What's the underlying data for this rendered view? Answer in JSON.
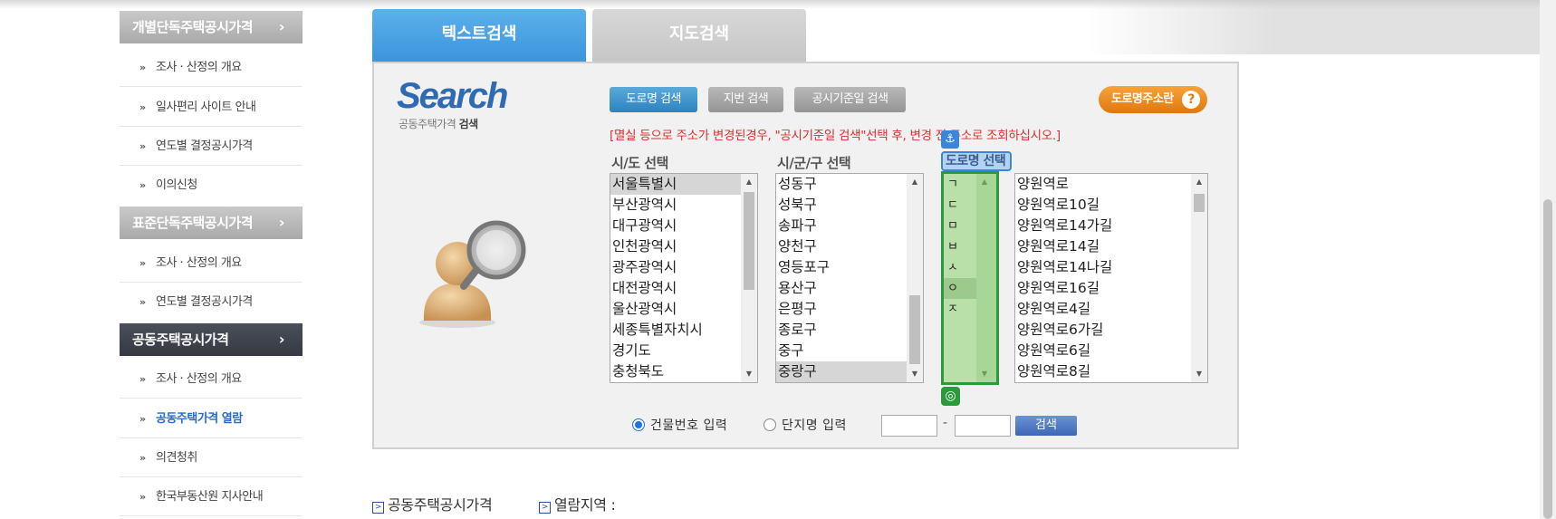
{
  "sidebar": {
    "sections": [
      {
        "title": "개별단독주택공시가격",
        "chevron": "›",
        "items": [
          "조사 · 산정의 개요",
          "일사편리 사이트 안내",
          "연도별 결정공시가격",
          "이의신청"
        ]
      },
      {
        "title": "표준단독주택공시가격",
        "chevron": "›",
        "items": [
          "조사 · 산정의 개요",
          "연도별 결정공시가격"
        ]
      },
      {
        "title": "공동주택공시가격",
        "chevron": "›",
        "items": [
          "조사 · 산정의 개요",
          "공동주택가격 열람",
          "의견청취",
          "한국부동산원 지사안내"
        ]
      }
    ],
    "bullet": "»"
  },
  "tabs": {
    "text_search": "텍스트검색",
    "map_search": "지도검색"
  },
  "search": {
    "logo": "Search",
    "logo_sub_prefix": "공동주택가격 ",
    "logo_sub_bold": "검색",
    "buttons": {
      "road": "도로명 검색",
      "lot": "지번 검색",
      "date": "공시기준일 검색",
      "road_addr": "도로명주소란",
      "help": "?"
    },
    "notice": "[멸실 등으로 주소가 변경된경우, \"공시기준일 검색\"선택 후, 변경 전 주소로 조회하십시오.]",
    "sido": {
      "title": "시/도 선택",
      "options": [
        "서울특별시",
        "부산광역시",
        "대구광역시",
        "인천광역시",
        "광주광역시",
        "대전광역시",
        "울산광역시",
        "세종특별자치시",
        "경기도",
        "충청북도"
      ],
      "selected": "서울특별시"
    },
    "sigungu": {
      "title": "시/군/구 선택",
      "options": [
        "성동구",
        "성북구",
        "송파구",
        "양천구",
        "영등포구",
        "용산구",
        "은평구",
        "종로구",
        "중구",
        "중랑구"
      ],
      "selected": "중랑구"
    },
    "road": {
      "title": "도로명 선택",
      "initials": [
        "ㄱ",
        "ㄷ",
        "ㅁ",
        "ㅂ",
        "ㅅ",
        "ㅇ",
        "ㅈ"
      ],
      "selected_initial": "ㅇ",
      "options": [
        "양원역로",
        "양원역로10길",
        "양원역로14가길",
        "양원역로14길",
        "양원역로14나길",
        "양원역로16길",
        "양원역로4길",
        "양원역로6가길",
        "양원역로6길",
        "양원역로8길"
      ]
    },
    "radio": {
      "building": "건물번호 입력",
      "complex": "단지명 입력"
    },
    "dash": "-",
    "go": "검색"
  },
  "overlay": {
    "anchor": "⚓",
    "target": "◎"
  },
  "footer": {
    "link1": "공동주택공시가격",
    "link2": "열람지역 :",
    "box": ">"
  }
}
